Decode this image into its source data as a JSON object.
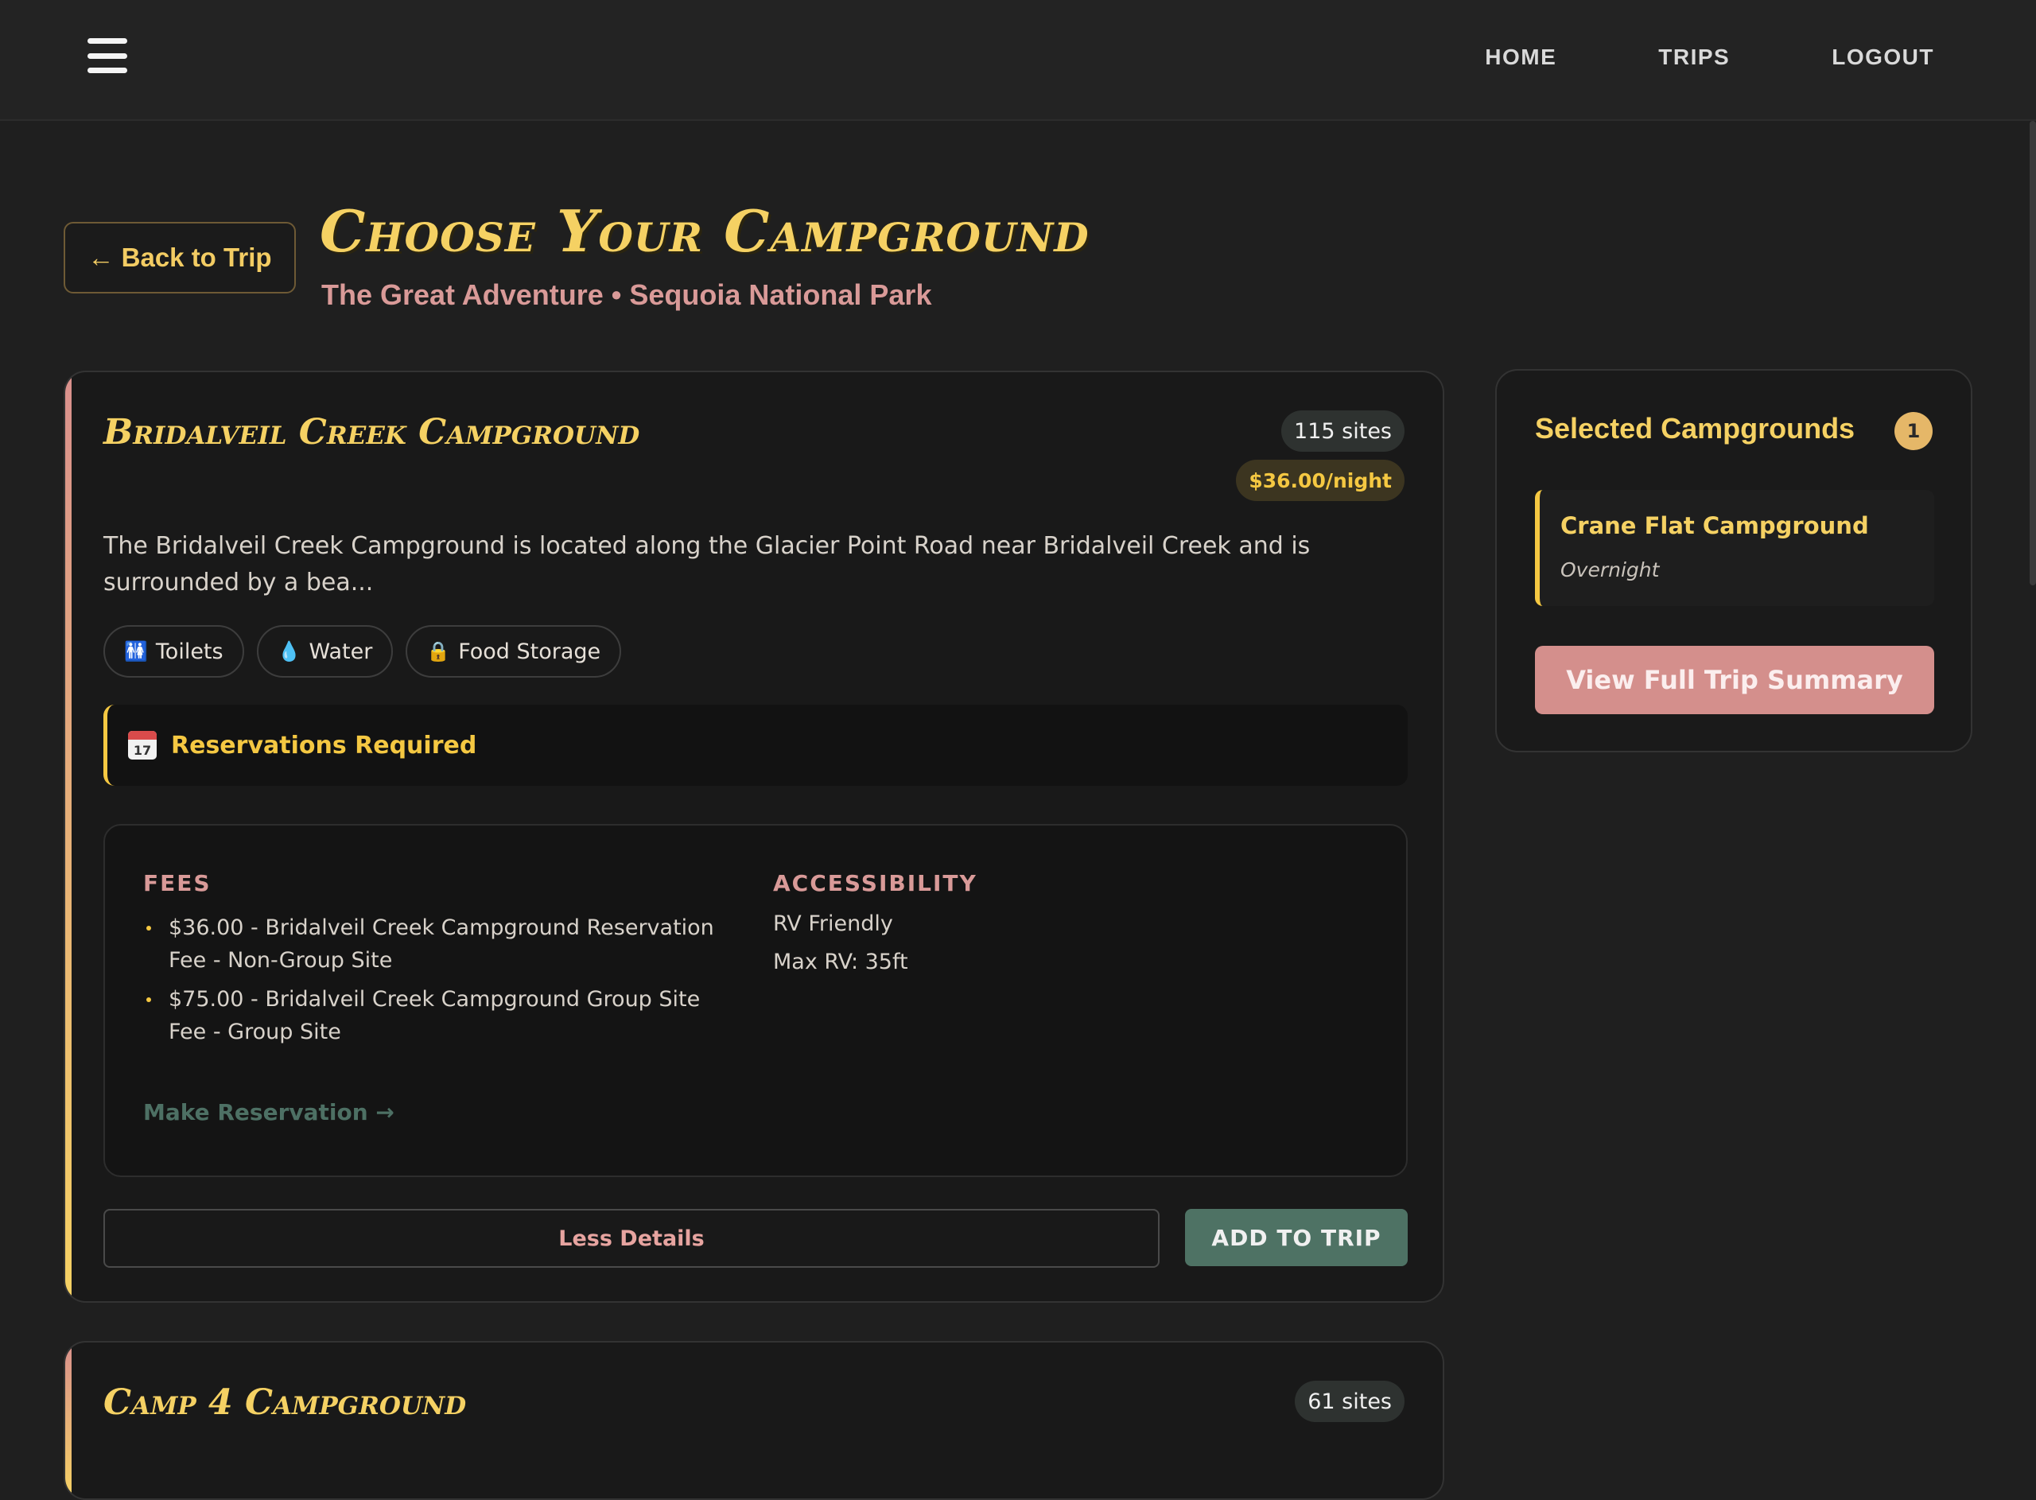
{
  "nav": {
    "menu_icon": "hamburger-menu-icon",
    "links": [
      "HOME",
      "TRIPS",
      "LOGOUT"
    ]
  },
  "header": {
    "back_label": "← Back to Trip",
    "title": "Choose Your Campground",
    "subtitle": "The Great Adventure • Sequoia National Park"
  },
  "campgrounds": [
    {
      "name": "Bridalveil Creek Campground",
      "sites": "115 sites",
      "price": "$36.00/night",
      "description": "The Bridalveil Creek Campground is located along the Glacier Point Road near Bridalveil Creek and is surrounded by a bea...",
      "amenities": [
        {
          "icon": "restroom-icon",
          "glyph": "🚻",
          "label": "Toilets"
        },
        {
          "icon": "water-drop-icon",
          "glyph": "💧",
          "label": "Water"
        },
        {
          "icon": "lock-icon",
          "glyph": "🔒",
          "label": "Food Storage"
        }
      ],
      "reservation_icon": "calendar-icon",
      "reservation_calendar_day": "17",
      "reservation_note": "Reservations Required",
      "fees_heading": "FEES",
      "fees": [
        "$36.00 - Bridalveil Creek Campground Reservation Fee - Non-Group Site",
        "$75.00 - Bridalveil Creek Campground Group Site Fee - Group Site"
      ],
      "accessibility_heading": "ACCESSIBILITY",
      "accessibility": [
        "RV Friendly",
        "Max RV: 35ft"
      ],
      "make_reservation": "Make Reservation →",
      "less_details": "Less Details",
      "add_to_trip": "ADD TO TRIP"
    },
    {
      "name": "Camp 4 Campground",
      "sites": "61 sites"
    }
  ],
  "sidebar": {
    "title": "Selected Campgrounds",
    "count": "1",
    "items": [
      {
        "name": "Crane Flat Campground",
        "type": "Overnight"
      }
    ],
    "summary_button": "View Full Trip Summary"
  },
  "colors": {
    "accent_yellow": "#f5d163",
    "accent_pink": "#d99a98",
    "button_green": "#4e7264",
    "background": "#1f1f1f"
  }
}
